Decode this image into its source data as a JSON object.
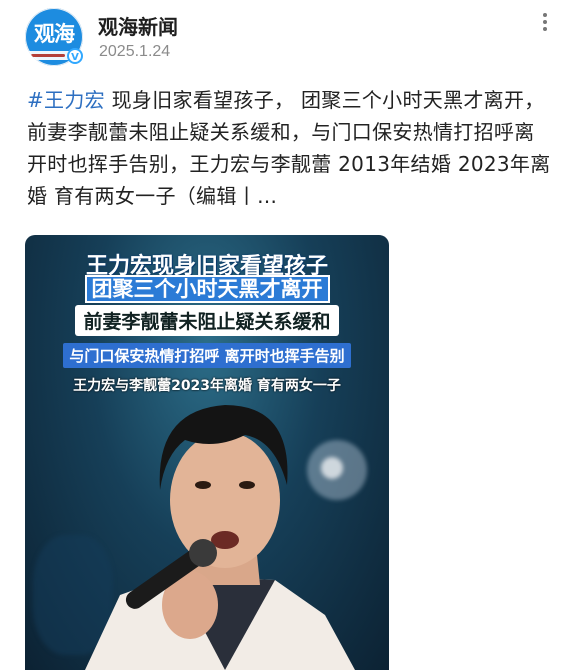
{
  "post": {
    "author_name": "观海新闻",
    "avatar_logo_text": "观海",
    "date": "2025.1.24",
    "hashtag": "#王力宏",
    "body_text": " 现身旧家看望孩子， 团聚三个小时天黑才离开，前妻李靓蕾未阻止疑关系缓和，与门口保安热情打招呼离开时也挥手告别，王力宏与李靓蕾 2013年结婚 2023年离婚 育有两女一子（编辑丨…"
  },
  "media": {
    "caption_line1": "王力宏现身旧家看望孩子",
    "caption_line2": "团聚三个小时天黑才离开",
    "caption_line3": "前妻李靓蕾未阻止疑关系缓和",
    "caption_line4": "与门口保安热情打招呼 离开时也挥手告别",
    "caption_line5": "王力宏与李靓蕾2023年离婚 育有两女一子"
  },
  "icons": {
    "more": "more-vertical-icon",
    "verified": "verified-icon"
  },
  "colors": {
    "hashtag": "#2d6fc1",
    "avatar_bg": "#1d8ce0",
    "caption_highlight": "#2b7bd6"
  }
}
